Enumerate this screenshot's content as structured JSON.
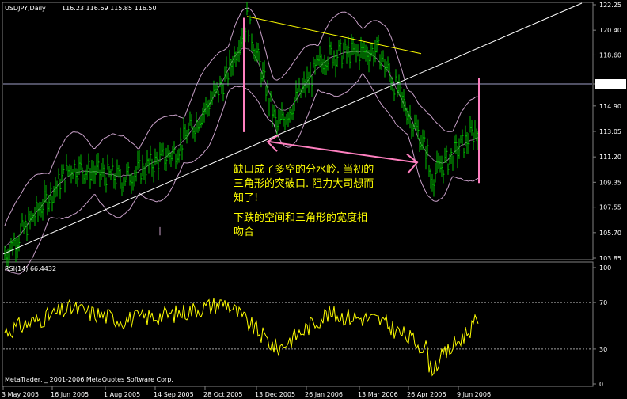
{
  "header": {
    "symbol": "USDJPY,Daily",
    "ohlc": "116.23 116.69 115.85 116.50"
  },
  "rsi_panel": {
    "label": "RSI(14) 66.4432"
  },
  "footer": {
    "copyright": "MetaTrader, _ 2001-2006 MetaQuotes Software Corp."
  },
  "annotations": [
    "缺口成了多空的分水岭. 当初的",
    "三角形的突破口. 阻力大司想而",
    "知了!",
    "下跌的空间和三角形的宽度相",
    "吻合"
  ],
  "colors": {
    "background": "#000000",
    "candles": "#00c000",
    "bands": "#c8a0c8",
    "trendline": "#ffffff",
    "triangle_top": "#ffff00",
    "markers": "#ff80c0",
    "rsi_line": "#ffff00",
    "annotation_text": "#ffff00",
    "current_price_line": "#a0a0c8"
  },
  "chart_data": [
    {
      "type": "line",
      "title": "USDJPY,Daily",
      "price_axis_labels": [
        "122.25",
        "120.40",
        "118.60",
        "116.50",
        "114.90",
        "113.05",
        "111.20",
        "109.35",
        "107.55",
        "105.70",
        "103.85"
      ],
      "ylim": [
        103.85,
        122.25
      ],
      "date_axis_labels": [
        "3 May 2005",
        "16 Jun 2005",
        "1 Aug 2005",
        "14 Sep 2005",
        "28 Oct 2005",
        "13 Dec 2005",
        "26 Jan 2006",
        "13 Mar 2006",
        "26 Apr 2006",
        "9 Jun 2006"
      ],
      "current_price": 116.5,
      "series": [
        {
          "dates": [
            "3 May 2005",
            "16 Jun 2005",
            "1 Aug 2005",
            "14 Sep 2005",
            "28 Oct 2005",
            "2 Nov 2005",
            "13 Dec 2005",
            "26 Jan 2006",
            "13 Mar 2006",
            "26 Apr 2006",
            "15 May 2006",
            "9 Jun 2006",
            "20 Jun 2006"
          ],
          "values": [
            104.1,
            110.5,
            109.6,
            111.5,
            116.8,
            121.2,
            113.3,
            118.6,
            118.9,
            111.5,
            109.6,
            113.3,
            116.5
          ]
        }
      ],
      "rsi": {
        "label": "RSI(14) 66.4432",
        "axis_labels": [
          "100",
          "70",
          "30",
          "0"
        ],
        "levels": [
          70,
          30
        ],
        "ylim": [
          0,
          100
        ],
        "dates": [
          "3 May 2005",
          "16 Jun 2005",
          "1 Aug 2005",
          "14 Sep 2005",
          "28 Oct 2005",
          "13 Dec 2005",
          "26 Jan 2006",
          "13 Mar 2006",
          "26 Apr 2006",
          "15 May 2006",
          "9 Jun 2006",
          "20 Jun 2006"
        ],
        "values": [
          45,
          65,
          55,
          60,
          70,
          30,
          60,
          55,
          30,
          12,
          55,
          66.4432
        ]
      }
    }
  ]
}
